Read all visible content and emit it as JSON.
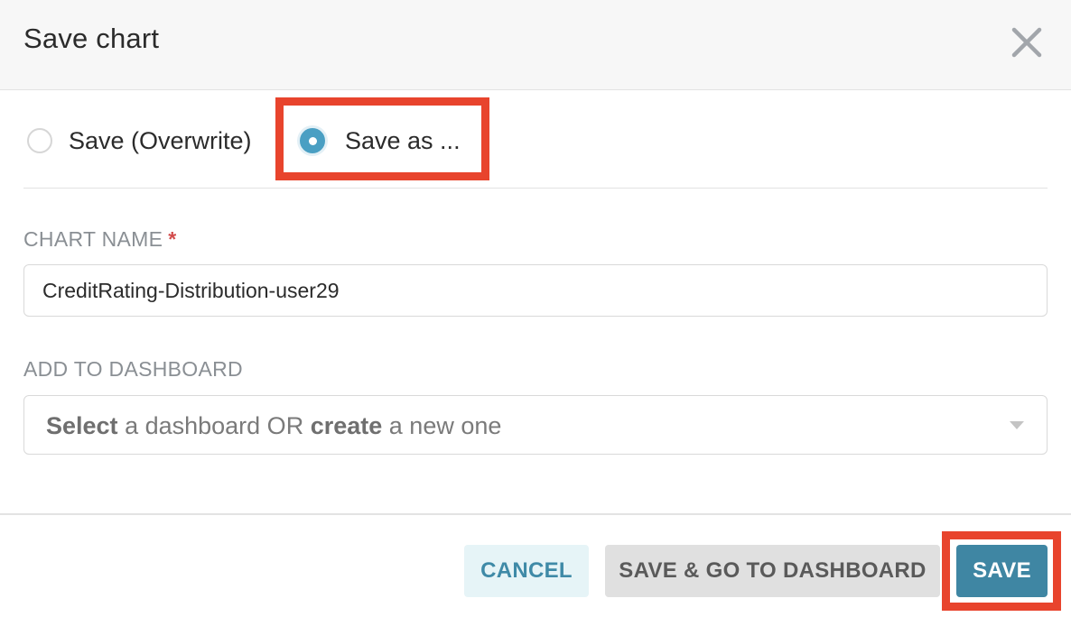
{
  "dialog": {
    "title": "Save chart",
    "close_icon": "close-icon"
  },
  "save_mode": {
    "options": [
      {
        "label": "Save (Overwrite)",
        "checked": false
      },
      {
        "label": "Save as ...",
        "checked": true
      }
    ]
  },
  "chart_name": {
    "label": "CHART NAME",
    "required_mark": "*",
    "value": "CreditRating-Distribution-user29"
  },
  "dashboard": {
    "label": "ADD TO DASHBOARD",
    "placeholder_part1": "Select",
    "placeholder_part2": " a dashboard OR ",
    "placeholder_part3": "create",
    "placeholder_part4": " a new one",
    "dropdown_icon": "chevron-down-icon"
  },
  "footer": {
    "cancel_label": "CANCEL",
    "save_dashboard_label": "SAVE & GO TO DASHBOARD",
    "save_label": "SAVE"
  },
  "colors": {
    "accent": "#4a9fc3",
    "primary_button": "#3f86a3",
    "highlight": "#e8442d",
    "required": "#d24b4b"
  }
}
